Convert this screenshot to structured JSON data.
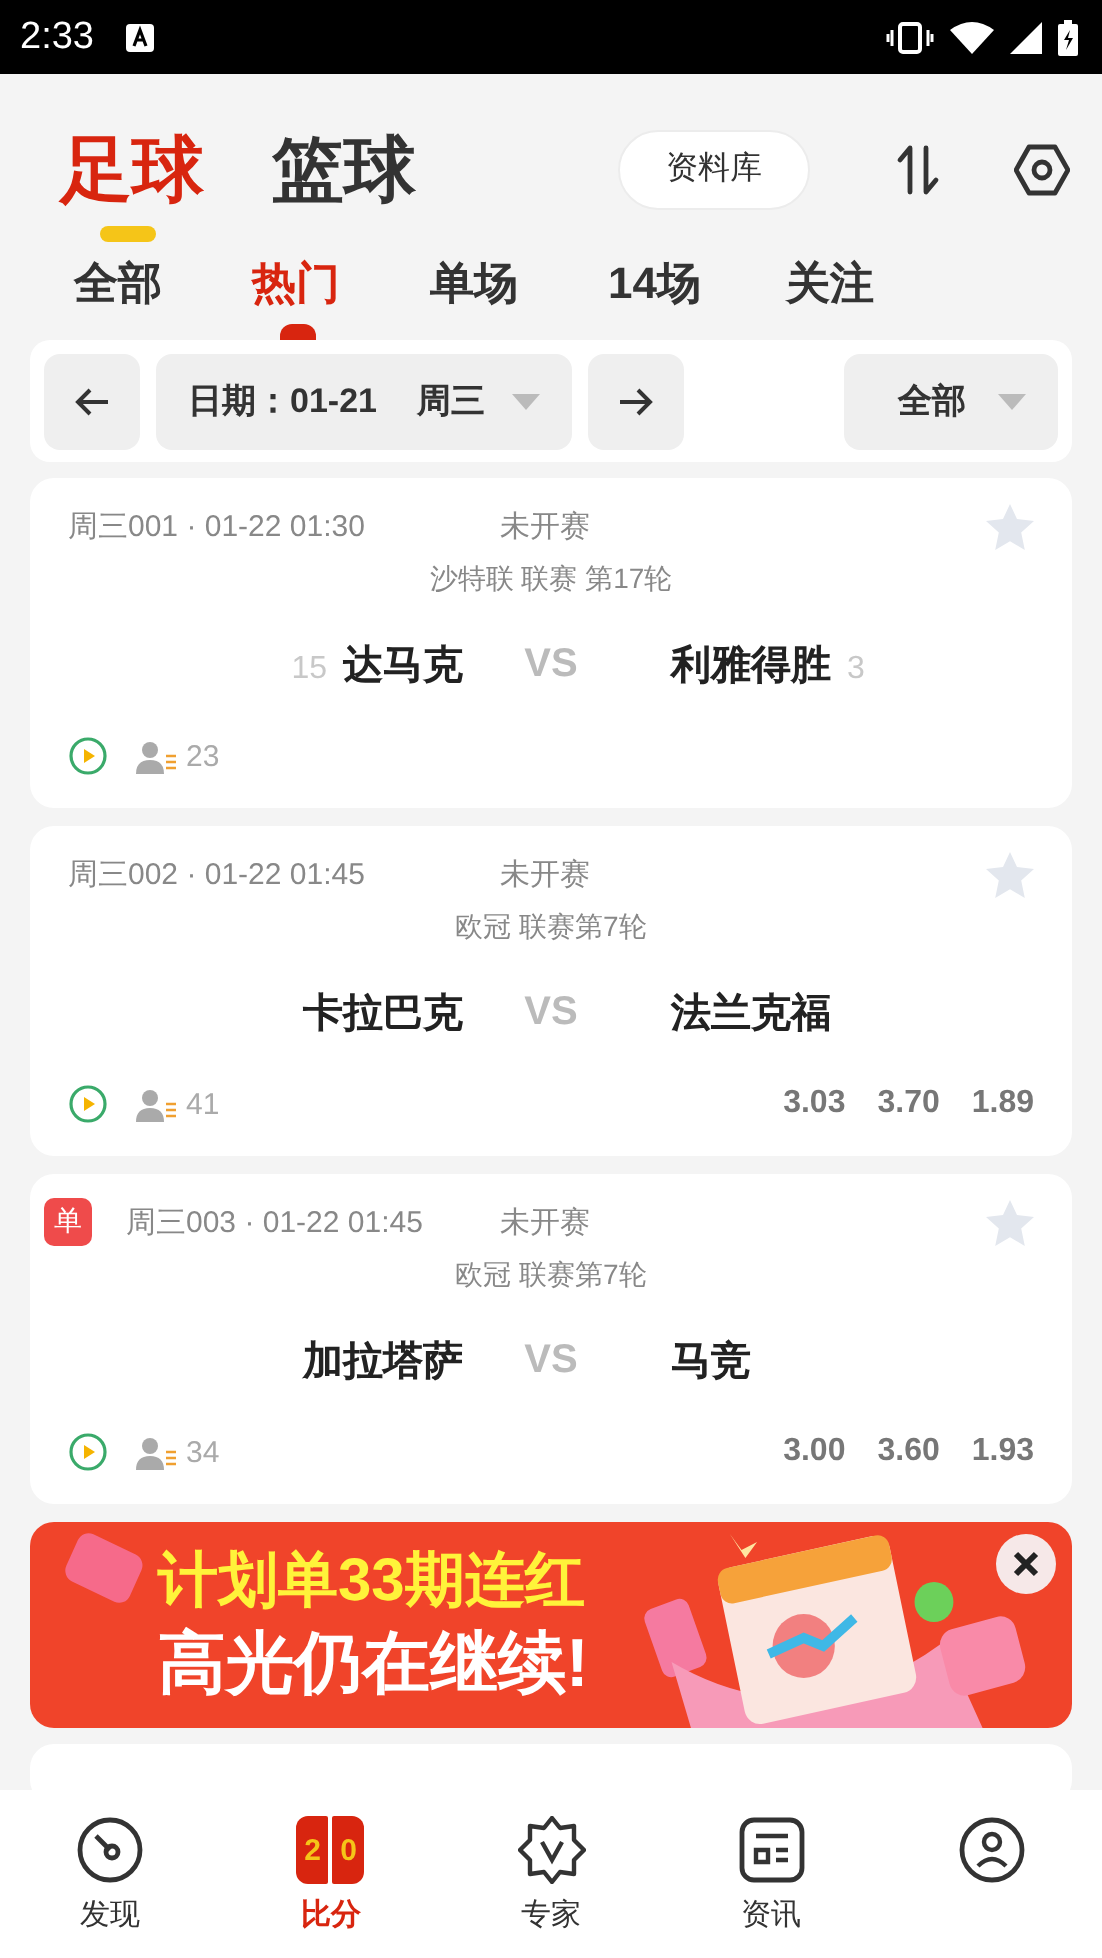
{
  "status_bar": {
    "time": "2:33"
  },
  "sports_tabs": [
    {
      "label": "足球",
      "selected": true
    },
    {
      "label": "篮球",
      "selected": false
    }
  ],
  "library_button": "资料库",
  "filter_tabs": [
    {
      "label": "全部",
      "selected": false
    },
    {
      "label": "热门",
      "selected": true
    },
    {
      "label": "单场",
      "selected": false
    },
    {
      "label": "14场",
      "selected": false
    },
    {
      "label": "关注",
      "selected": false
    }
  ],
  "date_bar": {
    "date": "日期：01-21",
    "weekday": "周三",
    "filter": "全部"
  },
  "matches": [
    {
      "code_time": "周三001 · 01-22 01:30",
      "status": "未开赛",
      "league": "沙特联 联赛 第17轮",
      "home": "达马克",
      "home_rank": "15",
      "vs": "VS",
      "away": "利雅得胜",
      "away_rank": "3",
      "followers": "23",
      "starred": false
    },
    {
      "code_time": "周三002 · 01-22 01:45",
      "status": "未开赛",
      "league": "欧冠 联赛第7轮",
      "home": "卡拉巴克",
      "vs": "VS",
      "away": "法兰克福",
      "followers": "41",
      "odds": [
        "3.03",
        "3.70",
        "1.89"
      ],
      "starred": false
    },
    {
      "badge": "单",
      "code_time": "周三003 · 01-22 01:45",
      "status": "未开赛",
      "league": "欧冠 联赛第7轮",
      "home": "加拉塔萨",
      "vs": "VS",
      "away": "马竞",
      "followers": "34",
      "odds": [
        "3.00",
        "3.60",
        "1.93"
      ],
      "starred": false
    }
  ],
  "banner": {
    "line1": "计划单33期连红",
    "line2": "高光仍在继续!"
  },
  "bottom_nav": [
    {
      "kind": "discover",
      "label": "发现",
      "selected": false
    },
    {
      "kind": "score",
      "score": [
        "2",
        "0"
      ],
      "label": "比分",
      "selected": true
    },
    {
      "kind": "expert",
      "label": "专家",
      "selected": false
    },
    {
      "kind": "news",
      "label": "资讯",
      "selected": false
    },
    {
      "kind": "profile",
      "selected": false
    }
  ]
}
